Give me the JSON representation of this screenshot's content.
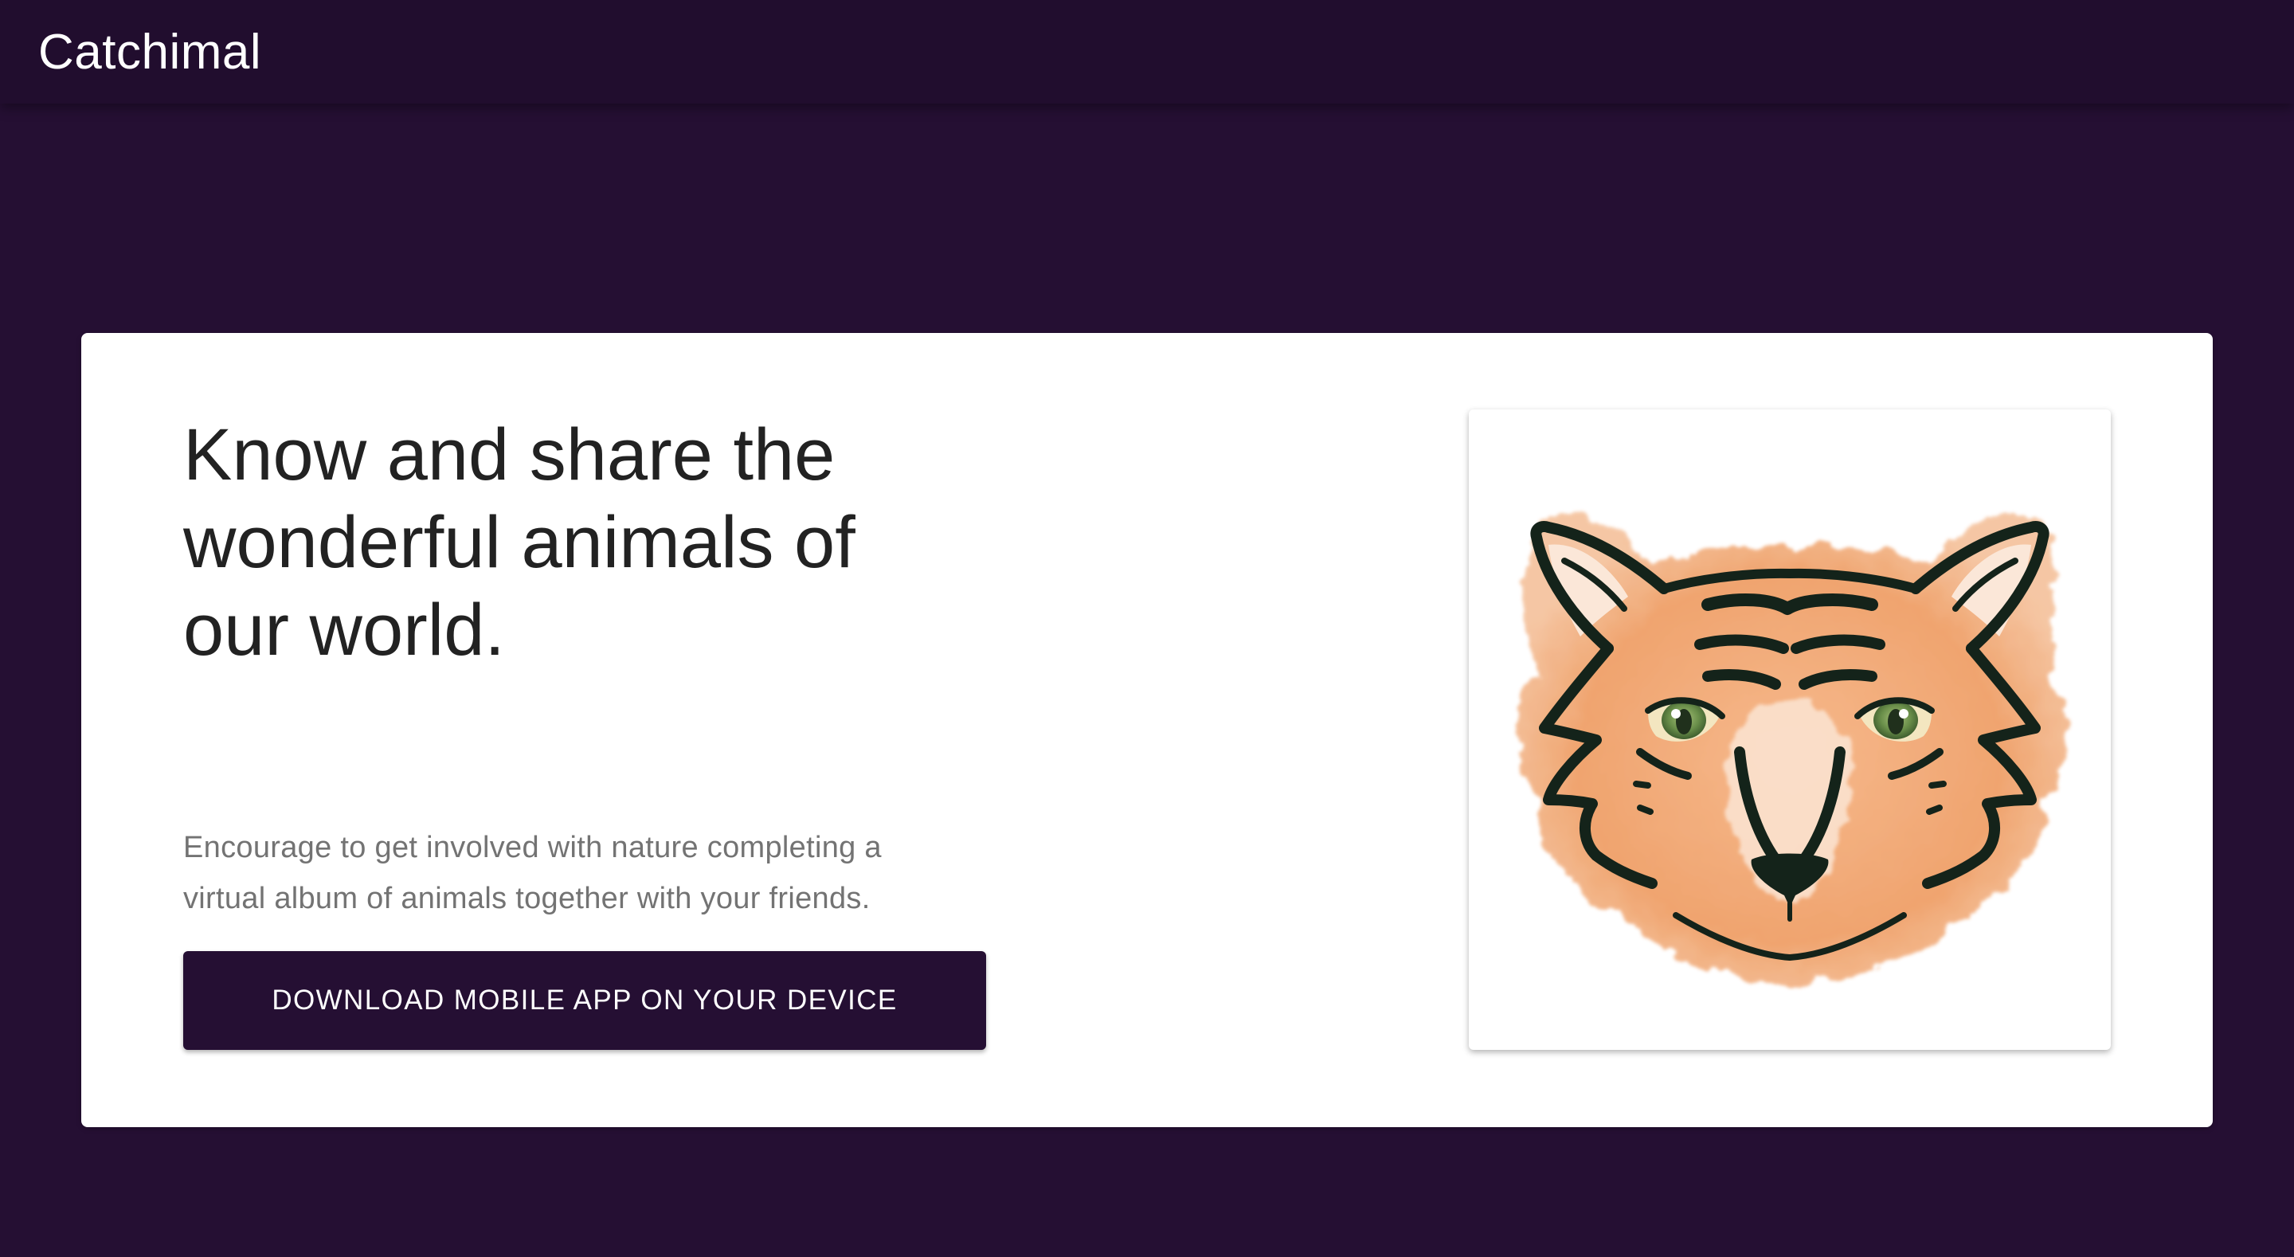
{
  "app_bar": {
    "title": "Catchimal"
  },
  "hero": {
    "headline": "Know and share the wonderful animals of our world.",
    "description": "Encourage to get involved with nature completing a virtual album of animals together with your friends.",
    "download_button_label": "DOWNLOAD MOBILE APP ON YOUR DEVICE"
  },
  "illustration": {
    "icon": "tiger-face-icon"
  },
  "colors": {
    "background": "#250f33",
    "app_bar": "#210d2e",
    "card": "#ffffff",
    "button": "#250f33",
    "tiger_fur": "#f0a06a",
    "tiger_stripes": "#14231a",
    "tiger_eyes": "#6a8f4a"
  }
}
